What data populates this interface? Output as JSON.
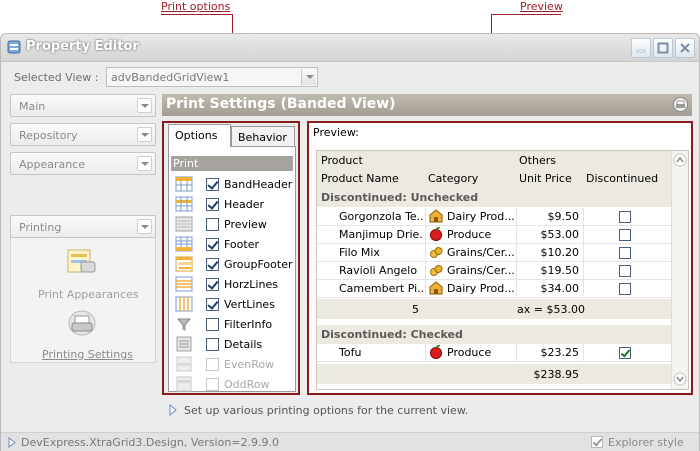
{
  "callouts": {
    "print_options": "Print options",
    "preview": "Preview"
  },
  "window": {
    "title": "Property Editor"
  },
  "selected_view": {
    "label": "Selected View :",
    "value": "advBandedGridView1"
  },
  "nav": {
    "items": [
      {
        "label": "Main"
      },
      {
        "label": "Repository"
      },
      {
        "label": "Appearance"
      },
      {
        "label": "Printing"
      }
    ],
    "printing_links": [
      {
        "label": "Print Appearances",
        "icon": "print-appearances-icon"
      },
      {
        "label": "Printing Settings",
        "icon": "printer-icon"
      }
    ]
  },
  "header": {
    "title": "Print Settings (Banded View)"
  },
  "tabs": [
    {
      "label": "Options"
    },
    {
      "label": "Behavior"
    }
  ],
  "print_section": "Print",
  "options": [
    {
      "label": "BandHeader",
      "checked": true,
      "enabled": true
    },
    {
      "label": "Header",
      "checked": true,
      "enabled": true
    },
    {
      "label": "Preview",
      "checked": false,
      "enabled": true
    },
    {
      "label": "Footer",
      "checked": true,
      "enabled": true
    },
    {
      "label": "GroupFooter",
      "checked": true,
      "enabled": true
    },
    {
      "label": "HorzLines",
      "checked": true,
      "enabled": true
    },
    {
      "label": "VertLines",
      "checked": true,
      "enabled": true
    },
    {
      "label": "FilterInfo",
      "checked": false,
      "enabled": true
    },
    {
      "label": "Details",
      "checked": false,
      "enabled": true
    },
    {
      "label": "EvenRow",
      "checked": false,
      "enabled": false
    },
    {
      "label": "OddRow",
      "checked": false,
      "enabled": false
    }
  ],
  "preview": {
    "label": "Preview:",
    "bands": {
      "product": "Product",
      "others": "Others"
    },
    "columns": {
      "name": "Product Name",
      "category": "Category",
      "price": "Unit Price",
      "discontinued": "Discontinued"
    },
    "groups": [
      {
        "title": "Discontinued: Unchecked",
        "rows": [
          {
            "name": "Gorgonzola Te...",
            "category": "Dairy Prod...",
            "cat_icon": "dairy-icon",
            "price": "$9.50",
            "discontinued": false
          },
          {
            "name": "Manjimup Drie...",
            "category": "Produce",
            "cat_icon": "produce-icon",
            "price": "$53.00",
            "discontinued": false
          },
          {
            "name": "Filo Mix",
            "category": "Grains/Cer...",
            "cat_icon": "grains-icon",
            "price": "$10.20",
            "discontinued": false
          },
          {
            "name": "Ravioli Angelo",
            "category": "Grains/Cer...",
            "cat_icon": "grains-icon",
            "price": "$19.50",
            "discontinued": false
          },
          {
            "name": "Camembert Pi...",
            "category": "Dairy Prod...",
            "cat_icon": "dairy-icon",
            "price": "$34.00",
            "discontinued": false
          }
        ],
        "footer_count": "5",
        "footer_summary": "ax = $53.00"
      },
      {
        "title": "Discontinued: Checked",
        "rows": [
          {
            "name": "Tofu",
            "category": "Produce",
            "cat_icon": "produce-icon",
            "price": "$23.25",
            "discontinued": true
          }
        ],
        "footer_total": "$238.95"
      }
    ]
  },
  "hint": "Set up various printing options for the current view.",
  "status": {
    "text": "DevExpress.XtraGrid3.Design, Version=2.9.9.0",
    "explorer_label": "Explorer style"
  },
  "colors": {
    "accent_border": "#8b1a1a",
    "header_bar": "#a39d92",
    "callout": "#a0202a"
  }
}
